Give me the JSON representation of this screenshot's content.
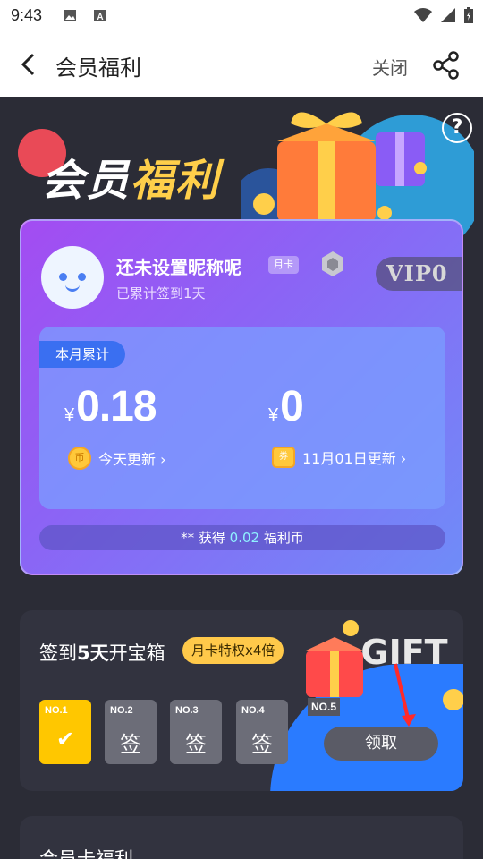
{
  "status_bar": {
    "time": "9:43"
  },
  "nav": {
    "title": "会员福利",
    "close_label": "关闭"
  },
  "hero": {
    "title_white": "会员",
    "title_gold": "福利",
    "help_label": "?"
  },
  "member": {
    "nickname": "还未设置昵称呢",
    "card_badge": "月卡",
    "checkin_total": "已累计签到1天",
    "vip_badge": "VIP0"
  },
  "stats": {
    "month_tag": "本月累计",
    "currency": "¥",
    "left_value": "0.18",
    "right_value": "0",
    "left_icon_label": "币",
    "right_icon_label": "券",
    "left_link": "今天更新 ›",
    "right_link": "11月01日更新 ›"
  },
  "reward": {
    "prefix": "** 获得",
    "amount": "0.02",
    "suffix": "福利币"
  },
  "signin": {
    "title_prefix": "签到",
    "title_days": "5天",
    "title_suffix": "开宝箱",
    "privilege": "月卡特权x4倍",
    "days": [
      {
        "no": "NO.1",
        "mark": "✔"
      },
      {
        "no": "NO.2",
        "mark": "签"
      },
      {
        "no": "NO.3",
        "mark": "签"
      },
      {
        "no": "NO.4",
        "mark": "签"
      }
    ],
    "day5": "NO.5",
    "claim": "领取"
  },
  "next_section": {
    "title": "会员卡福利"
  },
  "colors": {
    "accent_gold": "#ffc700",
    "card_purple": "#a34cf2",
    "stats_blue": "#3a6ff1"
  }
}
